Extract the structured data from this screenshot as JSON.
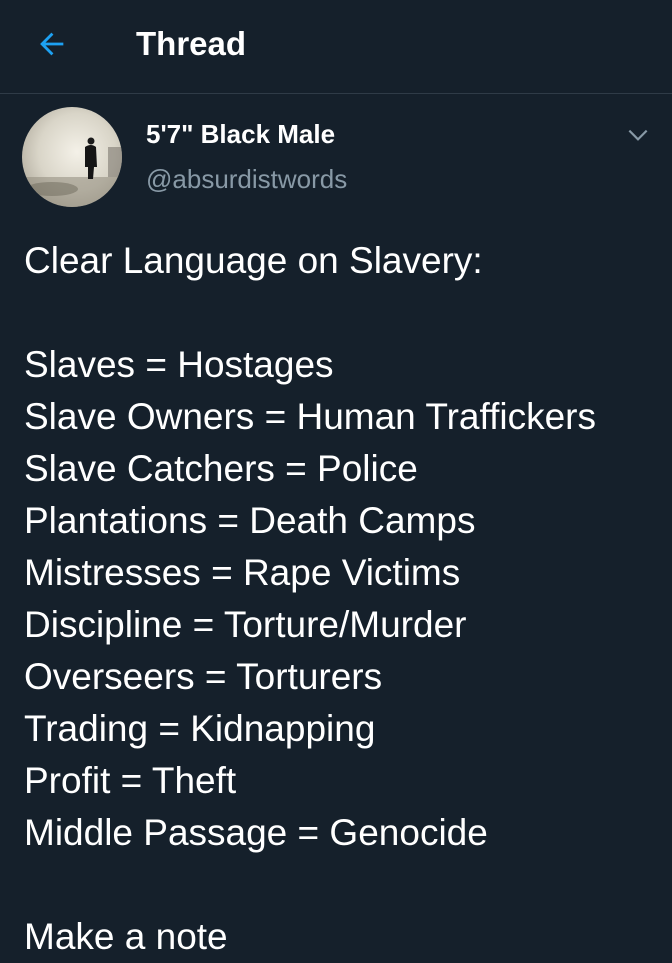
{
  "header": {
    "title": "Thread",
    "back_icon": "arrow-left-icon"
  },
  "tweet": {
    "display_name": "5'7\" Black Male",
    "handle": "@absurdistwords",
    "caret_icon": "chevron-down-icon",
    "heading": "Clear Language on Slavery:",
    "lines": [
      "Slaves = Hostages",
      "Slave Owners = Human Traffickers",
      "Slave Catchers = Police",
      "Plantations = Death Camps",
      "Mistresses = Rape Victims",
      "Discipline = Torture/Murder",
      "Overseers = Torturers",
      "Trading = Kidnapping",
      "Profit = Theft",
      "Middle Passage = Genocide"
    ],
    "closing": "Make a note"
  },
  "colors": {
    "background": "#15202b",
    "accent": "#1da1f2",
    "secondary_text": "#8899a6",
    "divider": "#2f3b47"
  }
}
